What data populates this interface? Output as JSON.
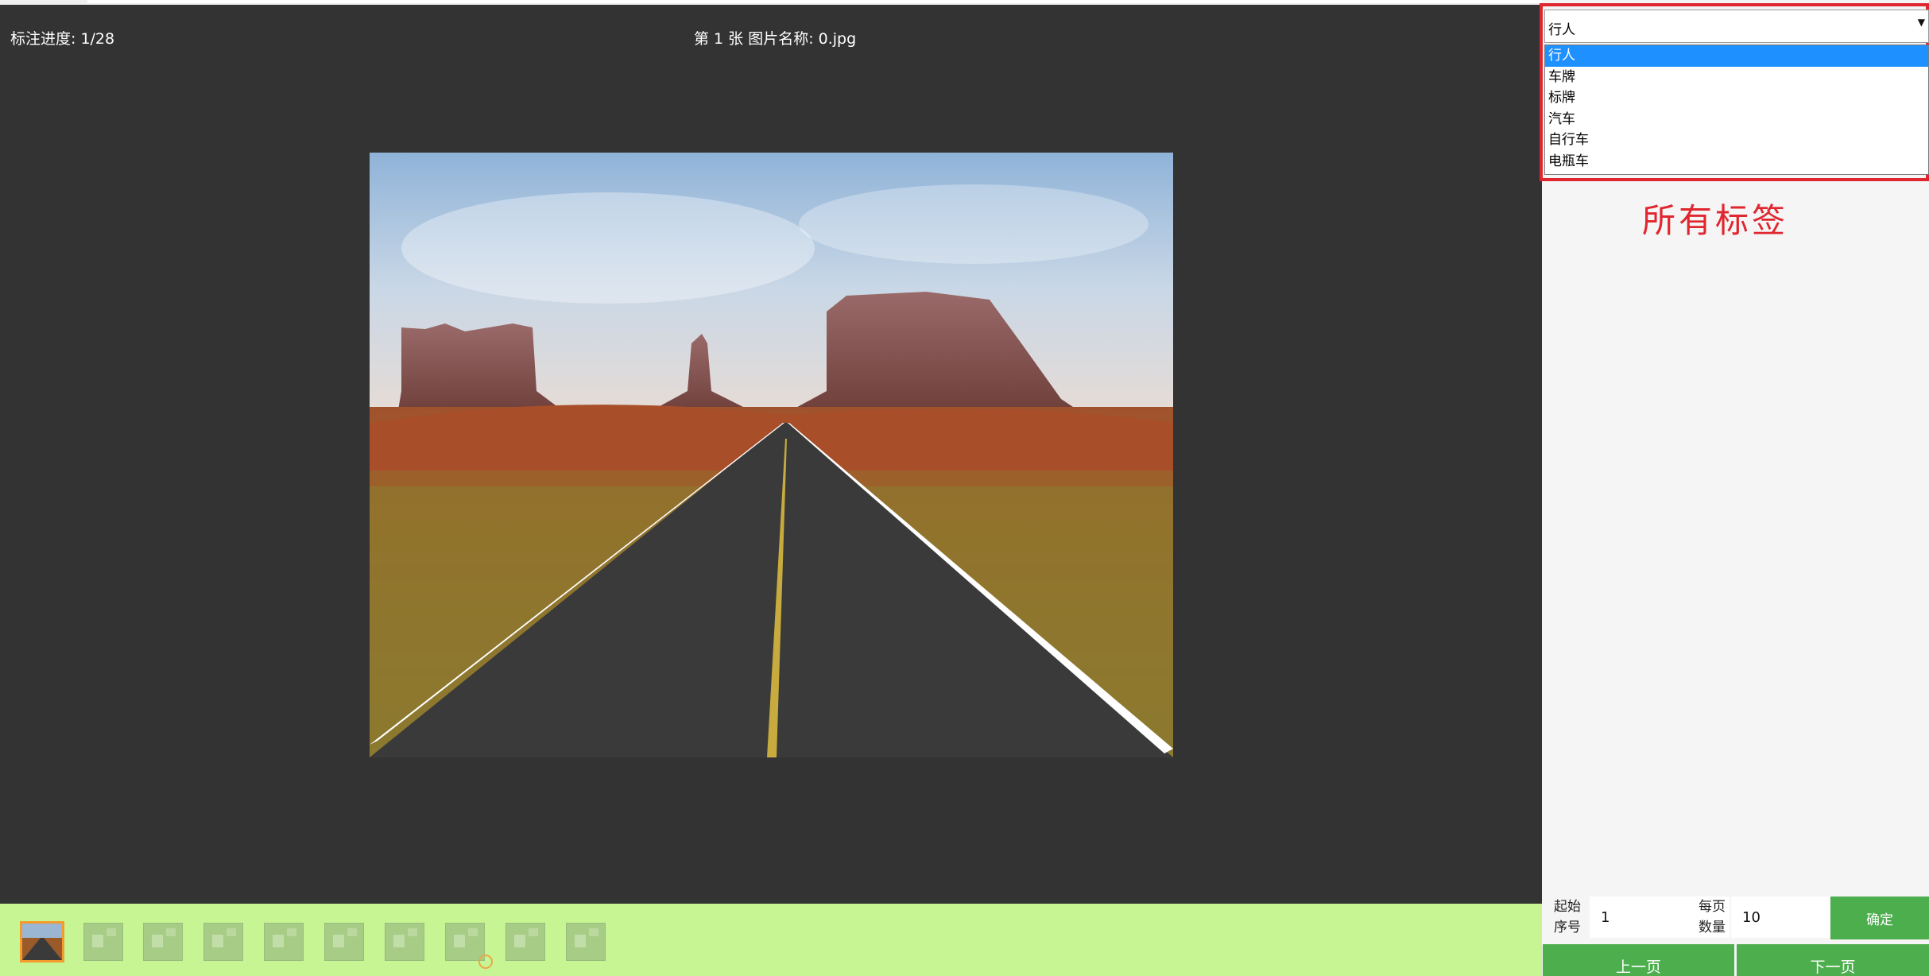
{
  "header": {
    "progress": "标注进度: 1/28",
    "image_title": "第 1 张 图片名称: 0.jpg"
  },
  "image": {
    "description_icon": "photo-desert-road"
  },
  "thumbnails": {
    "count": 10,
    "active_index": 0
  },
  "label_select": {
    "selected": "行人",
    "options": [
      "行人",
      "车牌",
      "标牌",
      "汽车",
      "自行车",
      "电瓶车"
    ],
    "highlighted_index": 0
  },
  "annotation_text": "所有标签",
  "pagination": {
    "start_label_line1": "起始",
    "start_label_line2": "序号",
    "start_value": "1",
    "per_page_label_line1": "每页",
    "per_page_label_line2": "数量",
    "per_page_value": "10",
    "confirm_label": "确定",
    "prev_label": "上一页",
    "next_label": "下一页"
  },
  "colors": {
    "viewer_bg": "#333333",
    "thumb_bar_bg": "#c8f594",
    "accent_green": "#4cae4c",
    "highlight_red": "#e0262f",
    "select_blue": "#1e90ff"
  }
}
